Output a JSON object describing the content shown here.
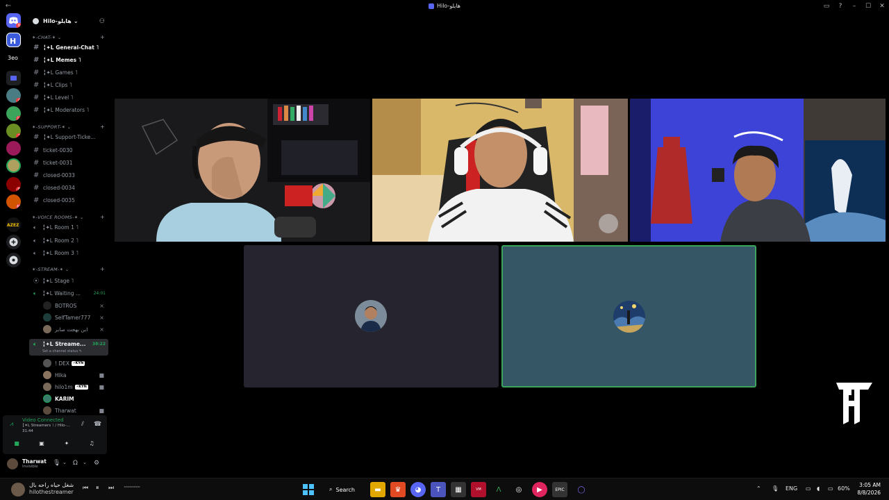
{
  "window": {
    "title": "Hilo-هايلو",
    "back_glyph": "←",
    "controls": [
      "▭",
      "?",
      "–",
      "☐",
      "✕"
    ]
  },
  "server_rail": {
    "badges": [
      "6",
      "4",
      "14",
      "2",
      "8",
      "4",
      "68"
    ]
  },
  "guild": {
    "name": "Hilo-هايلو",
    "chevron": "⌄",
    "invite_icon": "person-add-icon"
  },
  "categories": [
    {
      "label": "✶-CHAT-✶ ⌄",
      "plus": "+"
    },
    {
      "label": "✶-SUPPORT-✶ ⌄",
      "plus": "+"
    },
    {
      "label": "✶-VOICE ROOMS-✶ ⌄",
      "plus": "+"
    },
    {
      "label": "✶-STREAM-✶ ⌄",
      "plus": "+"
    }
  ],
  "channels": {
    "chat": [
      "╏✦L General-Chat ˥",
      "╏✦L Memes ˥",
      "╏✦L Games ˥",
      "╏✦L Clips ˥",
      "╏✦L Level ˥",
      "╏✦L Moderators ˥"
    ],
    "support": [
      "╏✦L Support-Ticke...",
      "ticket-0030",
      "ticket-0031",
      "closed-0033",
      "closed-0034",
      "closed-0035"
    ],
    "voice": [
      "╏✦L Room 1 ˥",
      "╏✦L Room 2 ˥",
      "╏✦L Room 3 ˥"
    ],
    "stream": {
      "stage": "╏✦L Stage ˥",
      "waiting": "╏✦L Waiting ...",
      "waiting_time": "24:01",
      "streamers": "╏✦L Streame...",
      "streamers_time": "38:22",
      "streamers_status": "Set a channel status ✎"
    }
  },
  "waiting_members": [
    "BOTROS",
    "SelfTamer777",
    "ابن بهجت صابر"
  ],
  "stream_members": [
    {
      "name": "! DEX",
      "tag": "⚡KYN"
    },
    {
      "name": "Hika",
      "tag": ""
    },
    {
      "name": "hilo1m",
      "tag": "⚡KYN"
    },
    {
      "name": "KARIM",
      "tag": ""
    },
    {
      "name": "Tharwat",
      "tag": ""
    }
  ],
  "voice_panel": {
    "status": "Video Connected",
    "channel": "╏✦L Streamers ˥ / Hilo-...",
    "elapsed": "31:44"
  },
  "user": {
    "name": "Tharwat",
    "status": "Invisible"
  },
  "taskbar": {
    "now_playing": "شغل حياه راحه بال",
    "artist": "hilothestreamer",
    "search_label": "Search",
    "lang": "ENG",
    "battery": "60%",
    "time": "3:05 AM",
    "date": "8/8/2026"
  },
  "colors": {
    "connected": "#23a55a",
    "speaking_border": "#3ba55c",
    "teal_tile": "#345665",
    "dark_tile": "#26252f"
  }
}
